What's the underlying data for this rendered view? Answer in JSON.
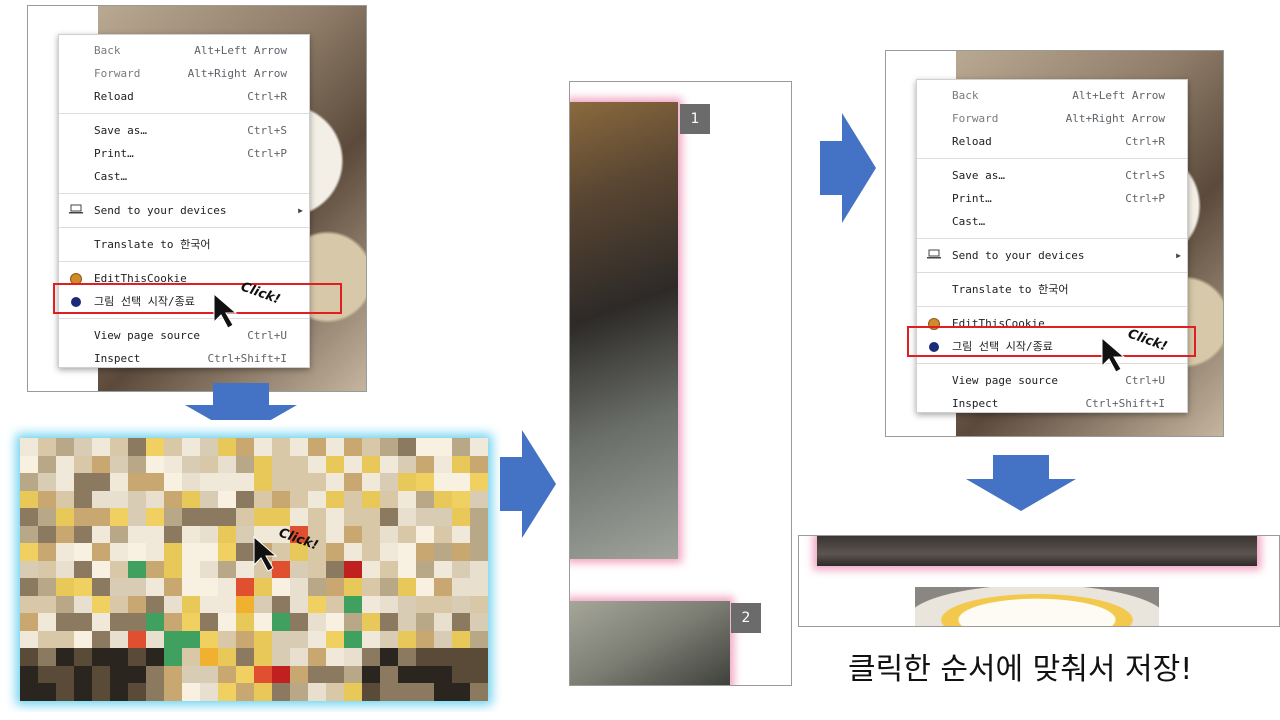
{
  "menu_a": {
    "items": [
      {
        "label": "Back",
        "shortcut": "Alt+Left Arrow"
      },
      {
        "label": "Forward",
        "shortcut": "Alt+Right Arrow"
      },
      {
        "label": "Reload",
        "shortcut": "Ctrl+R"
      },
      {
        "label": "Save as…",
        "shortcut": "Ctrl+S"
      },
      {
        "label": "Print…",
        "shortcut": "Ctrl+P"
      },
      {
        "label": "Cast…",
        "shortcut": ""
      },
      {
        "label": "Send to your devices",
        "shortcut": ""
      },
      {
        "label": "Translate to 한국어",
        "shortcut": ""
      },
      {
        "label": "EditThisCookie",
        "shortcut": ""
      },
      {
        "label": "그림 선택 시작/종료",
        "shortcut": ""
      },
      {
        "label": "View page source",
        "shortcut": "Ctrl+U"
      },
      {
        "label": "Inspect",
        "shortcut": "Ctrl+Shift+I"
      }
    ]
  },
  "menu_b": {
    "items": [
      {
        "label": "Back",
        "shortcut": "Alt+Left Arrow"
      },
      {
        "label": "Forward",
        "shortcut": "Alt+Right Arrow"
      },
      {
        "label": "Reload",
        "shortcut": "Ctrl+R"
      },
      {
        "label": "Save as…",
        "shortcut": "Ctrl+S"
      },
      {
        "label": "Print…",
        "shortcut": "Ctrl+P"
      },
      {
        "label": "Cast…",
        "shortcut": ""
      },
      {
        "label": "Send to your devices",
        "shortcut": ""
      },
      {
        "label": "Translate to 한국어",
        "shortcut": ""
      },
      {
        "label": "EditThisCookie",
        "shortcut": ""
      },
      {
        "label": "그림 선택 시작/종료",
        "shortcut": ""
      },
      {
        "label": "View page source",
        "shortcut": "Ctrl+U"
      },
      {
        "label": "Inspect",
        "shortcut": "Ctrl+Shift+I"
      }
    ]
  },
  "annotations": {
    "click_label": "Click!",
    "badge_1": "1",
    "badge_2": "2",
    "caption": "클릭한 순서에 맞춰서 저장!"
  },
  "colors": {
    "arrow": "#4472c4",
    "highlight": "#e02020",
    "selection_glow": "#f2a6c4",
    "mosaic_glow": "#6fd3f0"
  }
}
